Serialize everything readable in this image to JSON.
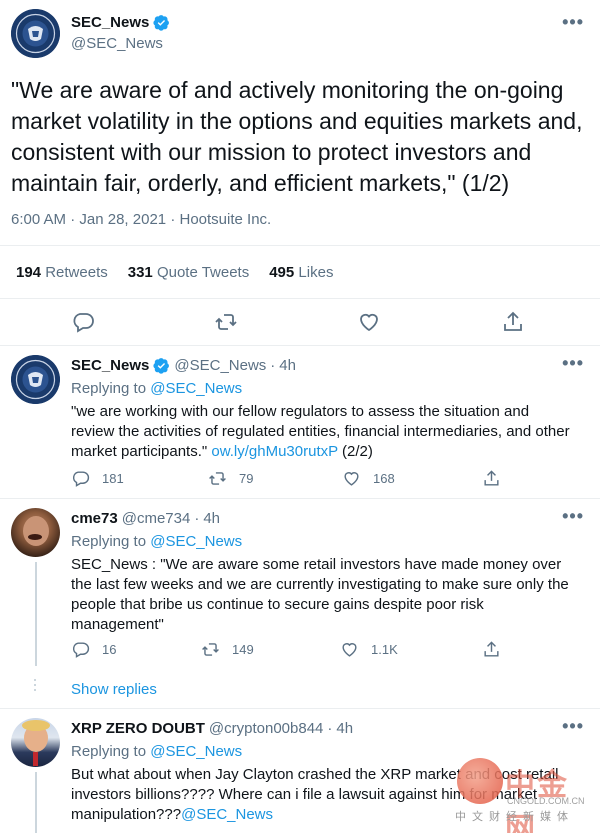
{
  "main_tweet": {
    "author_name": "SEC_News",
    "handle": "@SEC_News",
    "text": "\"We are aware of and actively monitoring the on-going market volatility in the options and equities markets and, consistent with our mission to protect investors and maintain fair, orderly, and efficient markets,\" (1/2)",
    "time": "6:00 AM",
    "date": "Jan 28, 2021",
    "source": "Hootsuite Inc.",
    "retweets_count": "194",
    "retweets_label": "Retweets",
    "quote_count": "331",
    "quote_label": "Quote Tweets",
    "likes_count": "495",
    "likes_label": "Likes"
  },
  "replies": [
    {
      "author_name": "SEC_News",
      "handle": "@SEC_News",
      "age": "4h",
      "replying_prefix": "Replying to",
      "replying_to": "@SEC_News",
      "text_before": "\"we are working with our fellow regulators to assess the situation and review the activities of regulated entities, financial intermediaries, and other market participants.\"",
      "link": "ow.ly/ghMu30rutxP",
      "text_after": "(2/2)",
      "replies": "181",
      "retweets": "79",
      "likes": "168"
    },
    {
      "author_name": "cme73",
      "handle": "@cme734",
      "age": "4h",
      "replying_prefix": "Replying to",
      "replying_to": "@SEC_News",
      "text": "SEC_News : \"We are aware some retail investors have made money over the last few weeks and we are currently investigating to make sure only the people that bribe us continue to secure gains despite poor risk management\"",
      "replies": "16",
      "retweets": "149",
      "likes": "1.1K",
      "show_replies": "Show replies"
    },
    {
      "author_name": "XRP ZERO DOUBT",
      "handle": "@crypton00b844",
      "age": "4h",
      "replying_prefix": "Replying to",
      "replying_to": "@SEC_News",
      "text": "But what about when Jay Clayton crashed the XRP market and cost retail investors billions???? Where can i file a lawsuit against him for market manipulation???",
      "mention": "@SEC_News"
    }
  ],
  "watermark": {
    "brand": "中金网",
    "url": "CNGOLD.COM.CN",
    "tagline": "中文财经新媒体"
  },
  "colors": {
    "link": "#1b95e0",
    "muted": "#5b7083",
    "divider": "#ebeef0"
  }
}
